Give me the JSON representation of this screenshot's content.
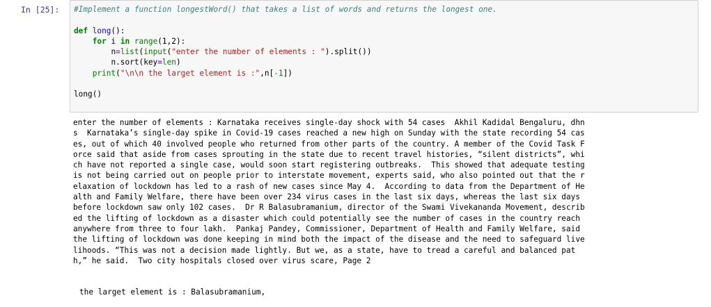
{
  "prompt": "In [25]:",
  "code": {
    "comment": "#Implement a function longestWord() that takes a list of words and returns the longest one.",
    "def_kw": "def",
    "func_name": "long",
    "def_rest": "():",
    "for_kw": "for",
    "for_var": " i ",
    "in_kw": "in",
    "range_fn": " range",
    "range_args": "(1,2):",
    "line3_a": "n",
    "line3_eq": "=",
    "line3_b": "list",
    "line3_c": "(",
    "line3_d": "input",
    "line3_e": "(",
    "line3_str": "\"enter the number of elements : \"",
    "line3_f": ").split())",
    "line4_a": "n.sort(key",
    "line4_eq": "=",
    "line4_b": "len",
    "line4_c": ")",
    "print_fn": "print",
    "print_open": "(",
    "print_str": "\"\\n\\n the larget element is :\"",
    "print_mid": ",n[",
    "print_num": "-1",
    "print_close": "])",
    "call": "long()"
  },
  "output": {
    "stream_lines": [
      "enter the number of elements : Karnataka receives single-day shock with 54 cases  Akhil Kadidal Bengaluru, dhn",
      "s  Karnataka’s single-day spike in Covid-19 cases reached a new high on Sunday with the state recording 54 cas",
      "es, out of which 40 involved people who returned from other parts of the country. A member of the Covid Task F",
      "orce said that aside from cases sprouting in the state due to recent travel histories, “silent districts”, whi",
      "ch have not reported a single case, would soon start registering outbreaks.  This showed that adequate testing",
      "is not being carried out on people prior to interstate movement, experts said, who also pointed out that the r",
      "elaxation of lockdown has led to a rash of new cases since May 4.  According to data from the Department of He",
      "alth and Family Welfare, there have been over 234 virus cases in the last six days, whereas the last six days",
      "before lockdown saw only 102 cases.  Dr R Balasubramanium, director of the Swami Vivekananda Movement, describ",
      "ed the lifting of lockdown as a disaster which could potentially see the number of cases in the country reach",
      "anywhere from three to four lakh.  Pankaj Pandey, Commissioner, Department of Health and Family Welfare, said",
      "the lifting of lockdown was done keeping in mind both the impact of the disease and the need to safeguard live",
      "lihoods. “This was not a decision made lightly. But we, as a state, have to tread a careful and balanced pat",
      "h,” he said.  Two city hospitals closed over virus scare, Page 2"
    ],
    "result": "the larget element is : Balasubramanium,"
  }
}
